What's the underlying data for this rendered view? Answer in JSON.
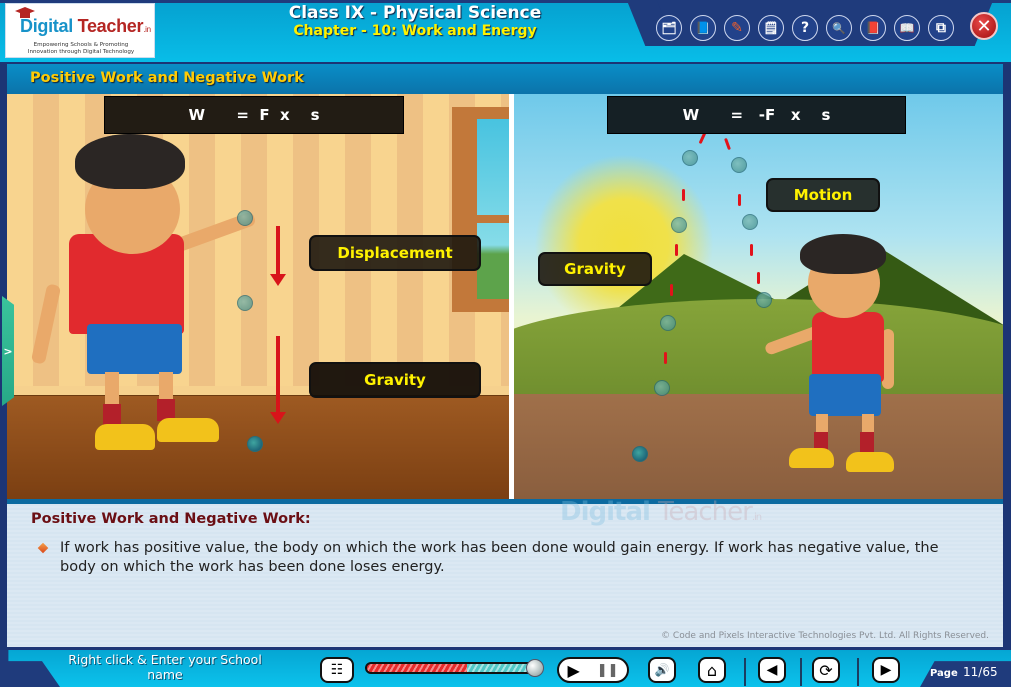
{
  "header": {
    "logo": {
      "brand_part1": "Digital",
      "brand_part2": "Teacher",
      "brand_suffix": ".in",
      "tagline_line1": "Empowering Schools & Promoting",
      "tagline_line2": "Innovation through Digital Technology"
    },
    "title": "Class IX - Physical Science",
    "subtitle": "Chapter - 10: Work and Energy",
    "toolbar": [
      {
        "name": "folder-clock-icon",
        "glyph": "🗂"
      },
      {
        "name": "book-icon",
        "glyph": "📘"
      },
      {
        "name": "drawing-board-icon",
        "glyph": "✎"
      },
      {
        "name": "notepad-icon",
        "glyph": "🗒"
      },
      {
        "name": "help-icon",
        "glyph": "?"
      },
      {
        "name": "zoom-magnifier-icon",
        "glyph": "🔍"
      },
      {
        "name": "red-book-icon",
        "glyph": "📕"
      },
      {
        "name": "open-book-icon",
        "glyph": "📖"
      },
      {
        "name": "window-resize-icon",
        "glyph": "⧉"
      }
    ],
    "close_glyph": "✕"
  },
  "slide": {
    "title": "Positive Work and Negative Work",
    "left_scene": {
      "formula": "W      =  F  x    s",
      "labels": {
        "displacement": "Displacement",
        "gravity": "Gravity"
      }
    },
    "right_scene": {
      "formula": "W      =   -F   x    s",
      "labels": {
        "gravity": "Gravity",
        "motion": "Motion"
      }
    },
    "side_tab_glyph": ">"
  },
  "panel": {
    "heading": "Positive Work and Negative Work:",
    "text": "If work has positive value, the body on which the work has been done would gain energy. If work has negative value, the body on which the work has been done loses energy.",
    "watermark": {
      "part1": "Digital",
      "part2": "Teacher",
      "suffix": ".in"
    },
    "copyright": "© Code and Pixels Interactive Technologies  Pvt. Ltd. All Rights Reserved."
  },
  "footer": {
    "school_text": "Right click & Enter your School name",
    "menu_glyph": "☷",
    "progress_fraction": 0.6,
    "play_glyph": "▶",
    "pause_glyph": "❚❚",
    "sound_glyph": "🔊",
    "home_glyph": "⌂",
    "prev_glyph": "◀",
    "reload_glyph": "⟳",
    "next_glyph": "▶",
    "page_label": "Page",
    "page_value": "11/65"
  }
}
